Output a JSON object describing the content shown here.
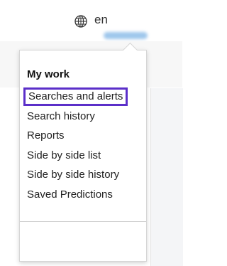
{
  "header": {
    "language_icon": "globe-icon",
    "language": "en"
  },
  "menu": {
    "heading": "My work",
    "items": [
      {
        "label": "Searches and alerts",
        "selected": true
      },
      {
        "label": "Search history",
        "selected": false
      },
      {
        "label": "Reports",
        "selected": false
      },
      {
        "label": "Side by side list",
        "selected": false
      },
      {
        "label": "Side by side history",
        "selected": false
      },
      {
        "label": "Saved Predictions",
        "selected": false
      }
    ]
  },
  "colors": {
    "selected_outline": "#5b2fc9",
    "blurred_username": "#9fc7ec"
  }
}
